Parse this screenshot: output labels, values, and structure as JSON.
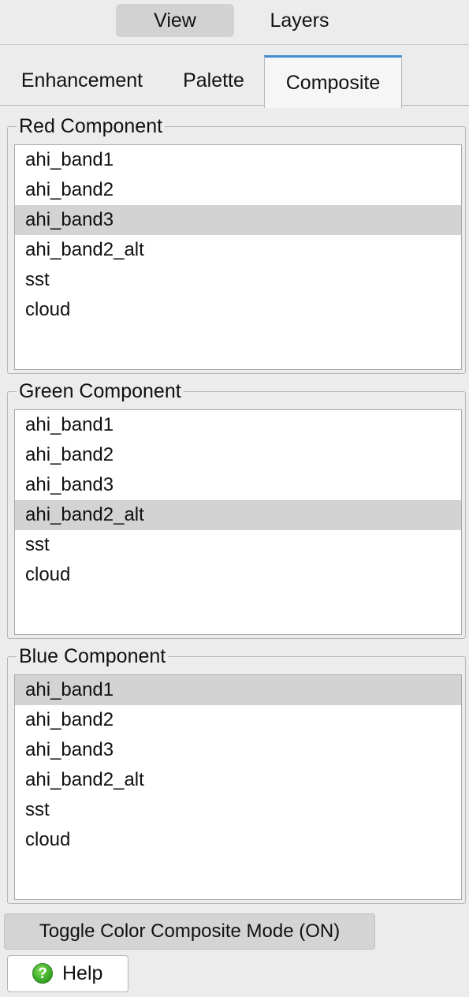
{
  "segmented": {
    "view_label": "View",
    "layers_label": "Layers"
  },
  "tabs": [
    {
      "label": "Enhancement"
    },
    {
      "label": "Palette"
    },
    {
      "label": "Composite"
    }
  ],
  "red": {
    "title": "Red Component",
    "items": [
      "ahi_band1",
      "ahi_band2",
      "ahi_band3",
      "ahi_band2_alt",
      "sst",
      "cloud"
    ],
    "selected": "ahi_band3"
  },
  "green": {
    "title": "Green Component",
    "items": [
      "ahi_band1",
      "ahi_band2",
      "ahi_band3",
      "ahi_band2_alt",
      "sst",
      "cloud"
    ],
    "selected": "ahi_band2_alt"
  },
  "blue": {
    "title": "Blue Component",
    "items": [
      "ahi_band1",
      "ahi_band2",
      "ahi_band3",
      "ahi_band2_alt",
      "sst",
      "cloud"
    ],
    "selected": "ahi_band1"
  },
  "toggle_label": "Toggle Color Composite Mode (ON)",
  "help": {
    "label": "Help",
    "icon": "question-mark-icon",
    "icon_glyph": "?"
  },
  "colors": {
    "active_tab_accent": "#3e8ed0",
    "selection_bg": "#d3d3d3",
    "help_icon": "#3fae2a"
  }
}
